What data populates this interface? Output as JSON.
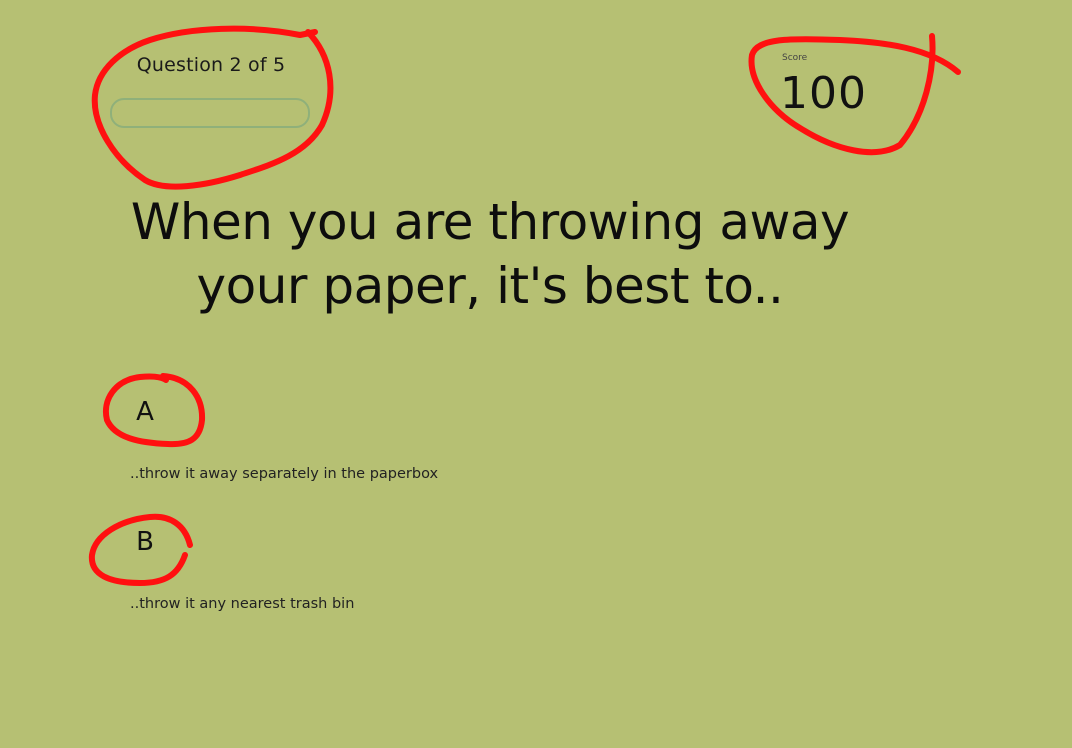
{
  "progress": {
    "label": "Question 2 of 5",
    "current": 2,
    "total": 5,
    "fraction": 0
  },
  "score": {
    "label": "Score",
    "value": "100"
  },
  "question": {
    "text": "When you are throwing away your paper, it's best to.."
  },
  "answers": [
    {
      "letter": "A",
      "text": "..throw it away separately in the paperbox"
    },
    {
      "letter": "B",
      "text": "..throw it any nearest trash bin"
    }
  ],
  "colors": {
    "background": "#b6c073",
    "progress_track": "#8fb07a",
    "annotation": "#ff1010",
    "text": "#111111"
  }
}
